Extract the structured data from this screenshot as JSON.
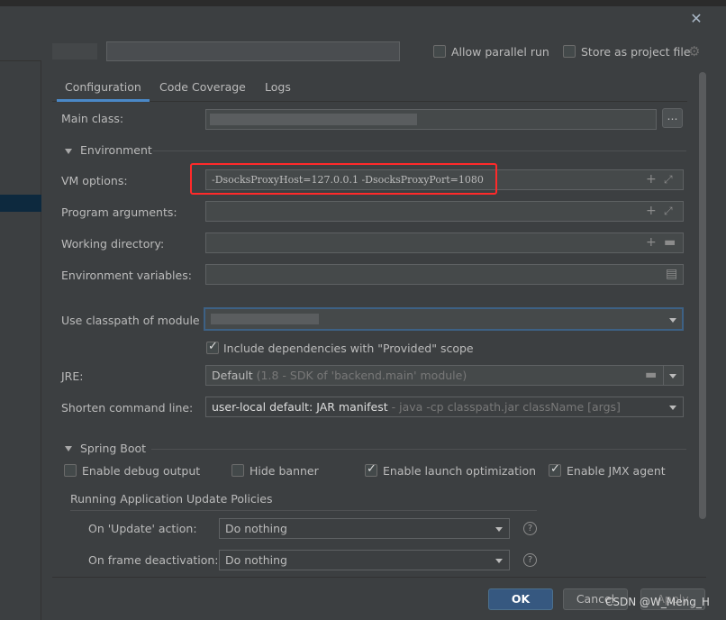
{
  "window": {
    "close_icon": "close-icon",
    "allow_parallel_run": "Allow parallel run",
    "store_as_project_file": "Store as project file",
    "gear_icon": "gear-icon"
  },
  "tabs": [
    "Configuration",
    "Code Coverage",
    "Logs"
  ],
  "config": {
    "main_class_label": "Main class:",
    "browse_label": "...",
    "environment_section": "Environment",
    "vm_options_label": "VM options:",
    "vm_options_value": "-DsocksProxyHost=127.0.0.1 -DsocksProxyPort=1080",
    "program_arguments_label": "Program arguments:",
    "working_directory_label": "Working directory:",
    "environment_variables_label": "Environment variables:",
    "classpath_label": "Use classpath of module",
    "include_provided_label": "Include dependencies with \"Provided\" scope",
    "jre_label": "JRE:",
    "jre_value": "Default",
    "jre_hint": "(1.8 - SDK of 'backend.main' module)",
    "shorten_label": "Shorten command line:",
    "shorten_value": "user-local default: JAR manifest",
    "shorten_hint": "- java -cp classpath.jar className [args]"
  },
  "spring_boot": {
    "section": "Spring Boot",
    "enable_debug_output": "Enable debug output",
    "hide_banner": "Hide banner",
    "enable_launch_optimization": "Enable launch optimization",
    "enable_jmx_agent": "Enable JMX agent",
    "update_policies_title": "Running Application Update Policies",
    "on_update_label": "On 'Update' action:",
    "on_update_value": "Do nothing",
    "on_frame_label": "On frame deactivation:",
    "on_frame_value": "Do nothing",
    "help_glyph": "?"
  },
  "buttons": {
    "ok": "OK",
    "cancel": "Cancel",
    "apply": "Apply"
  },
  "watermark": "CSDN @W_Meng_H",
  "colors": {
    "background": "#3c3f41",
    "accent": "#4a88c7",
    "ok_button": "#365880",
    "highlight_box": "#ff2a2a"
  }
}
